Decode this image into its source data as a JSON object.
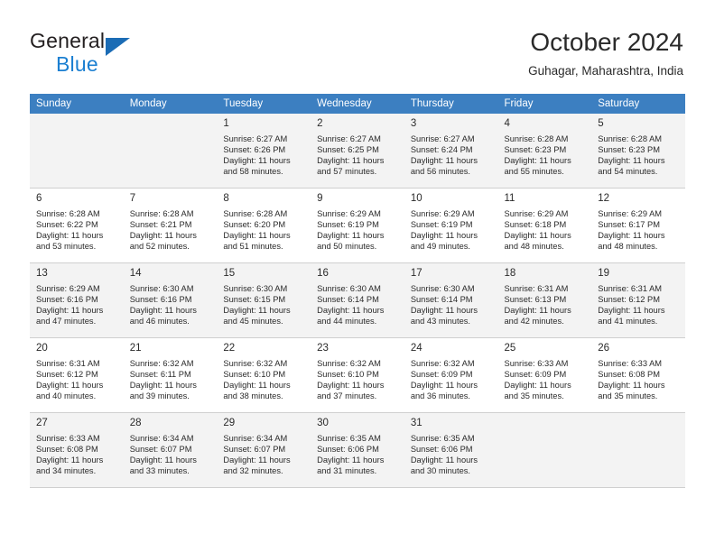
{
  "brand": {
    "name_part1": "General",
    "name_part2": "Blue",
    "logo_icon": "triangle-flag-icon"
  },
  "header": {
    "title": "October 2024",
    "subtitle": "Guhagar, Maharashtra, India"
  },
  "calendar": {
    "weekday_headers": [
      "Sunday",
      "Monday",
      "Tuesday",
      "Wednesday",
      "Thursday",
      "Friday",
      "Saturday"
    ],
    "accent_color": "#3c7fc1",
    "shaded_row_color": "#f3f3f3",
    "weeks": [
      [
        {
          "day": "",
          "detail": ""
        },
        {
          "day": "",
          "detail": ""
        },
        {
          "day": "1",
          "detail": "Sunrise: 6:27 AM\nSunset: 6:26 PM\nDaylight: 11 hours\nand 58 minutes."
        },
        {
          "day": "2",
          "detail": "Sunrise: 6:27 AM\nSunset: 6:25 PM\nDaylight: 11 hours\nand 57 minutes."
        },
        {
          "day": "3",
          "detail": "Sunrise: 6:27 AM\nSunset: 6:24 PM\nDaylight: 11 hours\nand 56 minutes."
        },
        {
          "day": "4",
          "detail": "Sunrise: 6:28 AM\nSunset: 6:23 PM\nDaylight: 11 hours\nand 55 minutes."
        },
        {
          "day": "5",
          "detail": "Sunrise: 6:28 AM\nSunset: 6:23 PM\nDaylight: 11 hours\nand 54 minutes."
        }
      ],
      [
        {
          "day": "6",
          "detail": "Sunrise: 6:28 AM\nSunset: 6:22 PM\nDaylight: 11 hours\nand 53 minutes."
        },
        {
          "day": "7",
          "detail": "Sunrise: 6:28 AM\nSunset: 6:21 PM\nDaylight: 11 hours\nand 52 minutes."
        },
        {
          "day": "8",
          "detail": "Sunrise: 6:28 AM\nSunset: 6:20 PM\nDaylight: 11 hours\nand 51 minutes."
        },
        {
          "day": "9",
          "detail": "Sunrise: 6:29 AM\nSunset: 6:19 PM\nDaylight: 11 hours\nand 50 minutes."
        },
        {
          "day": "10",
          "detail": "Sunrise: 6:29 AM\nSunset: 6:19 PM\nDaylight: 11 hours\nand 49 minutes."
        },
        {
          "day": "11",
          "detail": "Sunrise: 6:29 AM\nSunset: 6:18 PM\nDaylight: 11 hours\nand 48 minutes."
        },
        {
          "day": "12",
          "detail": "Sunrise: 6:29 AM\nSunset: 6:17 PM\nDaylight: 11 hours\nand 48 minutes."
        }
      ],
      [
        {
          "day": "13",
          "detail": "Sunrise: 6:29 AM\nSunset: 6:16 PM\nDaylight: 11 hours\nand 47 minutes."
        },
        {
          "day": "14",
          "detail": "Sunrise: 6:30 AM\nSunset: 6:16 PM\nDaylight: 11 hours\nand 46 minutes."
        },
        {
          "day": "15",
          "detail": "Sunrise: 6:30 AM\nSunset: 6:15 PM\nDaylight: 11 hours\nand 45 minutes."
        },
        {
          "day": "16",
          "detail": "Sunrise: 6:30 AM\nSunset: 6:14 PM\nDaylight: 11 hours\nand 44 minutes."
        },
        {
          "day": "17",
          "detail": "Sunrise: 6:30 AM\nSunset: 6:14 PM\nDaylight: 11 hours\nand 43 minutes."
        },
        {
          "day": "18",
          "detail": "Sunrise: 6:31 AM\nSunset: 6:13 PM\nDaylight: 11 hours\nand 42 minutes."
        },
        {
          "day": "19",
          "detail": "Sunrise: 6:31 AM\nSunset: 6:12 PM\nDaylight: 11 hours\nand 41 minutes."
        }
      ],
      [
        {
          "day": "20",
          "detail": "Sunrise: 6:31 AM\nSunset: 6:12 PM\nDaylight: 11 hours\nand 40 minutes."
        },
        {
          "day": "21",
          "detail": "Sunrise: 6:32 AM\nSunset: 6:11 PM\nDaylight: 11 hours\nand 39 minutes."
        },
        {
          "day": "22",
          "detail": "Sunrise: 6:32 AM\nSunset: 6:10 PM\nDaylight: 11 hours\nand 38 minutes."
        },
        {
          "day": "23",
          "detail": "Sunrise: 6:32 AM\nSunset: 6:10 PM\nDaylight: 11 hours\nand 37 minutes."
        },
        {
          "day": "24",
          "detail": "Sunrise: 6:32 AM\nSunset: 6:09 PM\nDaylight: 11 hours\nand 36 minutes."
        },
        {
          "day": "25",
          "detail": "Sunrise: 6:33 AM\nSunset: 6:09 PM\nDaylight: 11 hours\nand 35 minutes."
        },
        {
          "day": "26",
          "detail": "Sunrise: 6:33 AM\nSunset: 6:08 PM\nDaylight: 11 hours\nand 35 minutes."
        }
      ],
      [
        {
          "day": "27",
          "detail": "Sunrise: 6:33 AM\nSunset: 6:08 PM\nDaylight: 11 hours\nand 34 minutes."
        },
        {
          "day": "28",
          "detail": "Sunrise: 6:34 AM\nSunset: 6:07 PM\nDaylight: 11 hours\nand 33 minutes."
        },
        {
          "day": "29",
          "detail": "Sunrise: 6:34 AM\nSunset: 6:07 PM\nDaylight: 11 hours\nand 32 minutes."
        },
        {
          "day": "30",
          "detail": "Sunrise: 6:35 AM\nSunset: 6:06 PM\nDaylight: 11 hours\nand 31 minutes."
        },
        {
          "day": "31",
          "detail": "Sunrise: 6:35 AM\nSunset: 6:06 PM\nDaylight: 11 hours\nand 30 minutes."
        },
        {
          "day": "",
          "detail": ""
        },
        {
          "day": "",
          "detail": ""
        }
      ]
    ]
  }
}
